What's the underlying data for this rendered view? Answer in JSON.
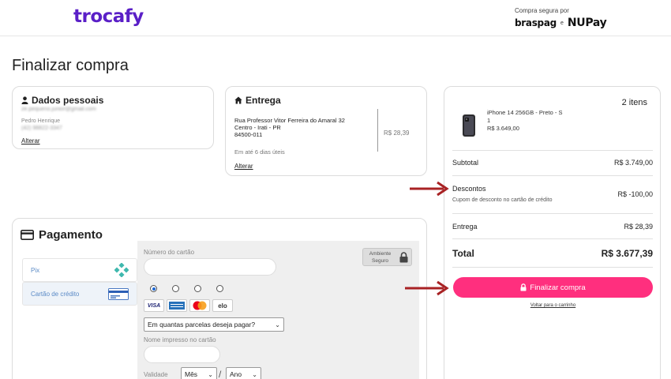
{
  "header": {
    "logo": "trocafy",
    "secure_label": "Compra segura por",
    "brand1": "braspag",
    "brand_and": "e",
    "brand2": "NUPay"
  },
  "page_title": "Finalizar compra",
  "dados": {
    "title": "Dados pessoais",
    "email": "ze.pequeno.junior@gmail.com",
    "name": "Pedro Henrique",
    "phone": "(42) 98822-3347",
    "change": "Alterar"
  },
  "entrega": {
    "title": "Entrega",
    "street": "Rua Professor Vitor Ferreira do Amaral 32",
    "city": "Centro - Irati - PR",
    "zip": "84500-011",
    "time": "Em até 6 dias úteis",
    "price": "R$ 28,39",
    "change": "Alterar"
  },
  "pagamento": {
    "title": "Pagamento",
    "methods": [
      {
        "label": "Pix",
        "icon": "pix-icon"
      },
      {
        "label": "Cartão de crédito",
        "icon": "credit-card-icon"
      }
    ],
    "card_number_label": "Número do cartão",
    "ambiente": "Ambiente Seguro",
    "ambiente_line1": "Ambiente",
    "ambiente_line2": "Seguro",
    "brands": [
      "VISA",
      "AMEX",
      "Mastercard",
      "elo"
    ],
    "installments_placeholder": "Em quantas parcelas deseja pagar?",
    "name_label": "Nome impresso no cartão",
    "validity_label": "Validade",
    "month_placeholder": "Mês",
    "year_placeholder": "Ano",
    "slash": "/"
  },
  "resumo": {
    "items_count": "2 itens",
    "product_name": "iPhone 14 256GB - Preto - S",
    "product_qty": "1",
    "product_price": "R$ 3.649,00",
    "subtotal_label": "Subtotal",
    "subtotal_value": "R$ 3.749,00",
    "desc_label": "Descontos",
    "desc_sub": "Cupom de desconto no cartão de crédito",
    "desc_value": "R$ -100,00",
    "entrega_label": "Entrega",
    "entrega_value": "R$ 28,39",
    "total_label": "Total",
    "total_value": "R$ 3.677,39",
    "button": "Finalizar compra",
    "back": "Voltar para o carrinho"
  },
  "colors": {
    "brand_purple": "#5a1fc7",
    "cta_pink": "#ff2f7e",
    "annotation_arrow": "#a82224",
    "link_blue": "#5a8ac6"
  }
}
